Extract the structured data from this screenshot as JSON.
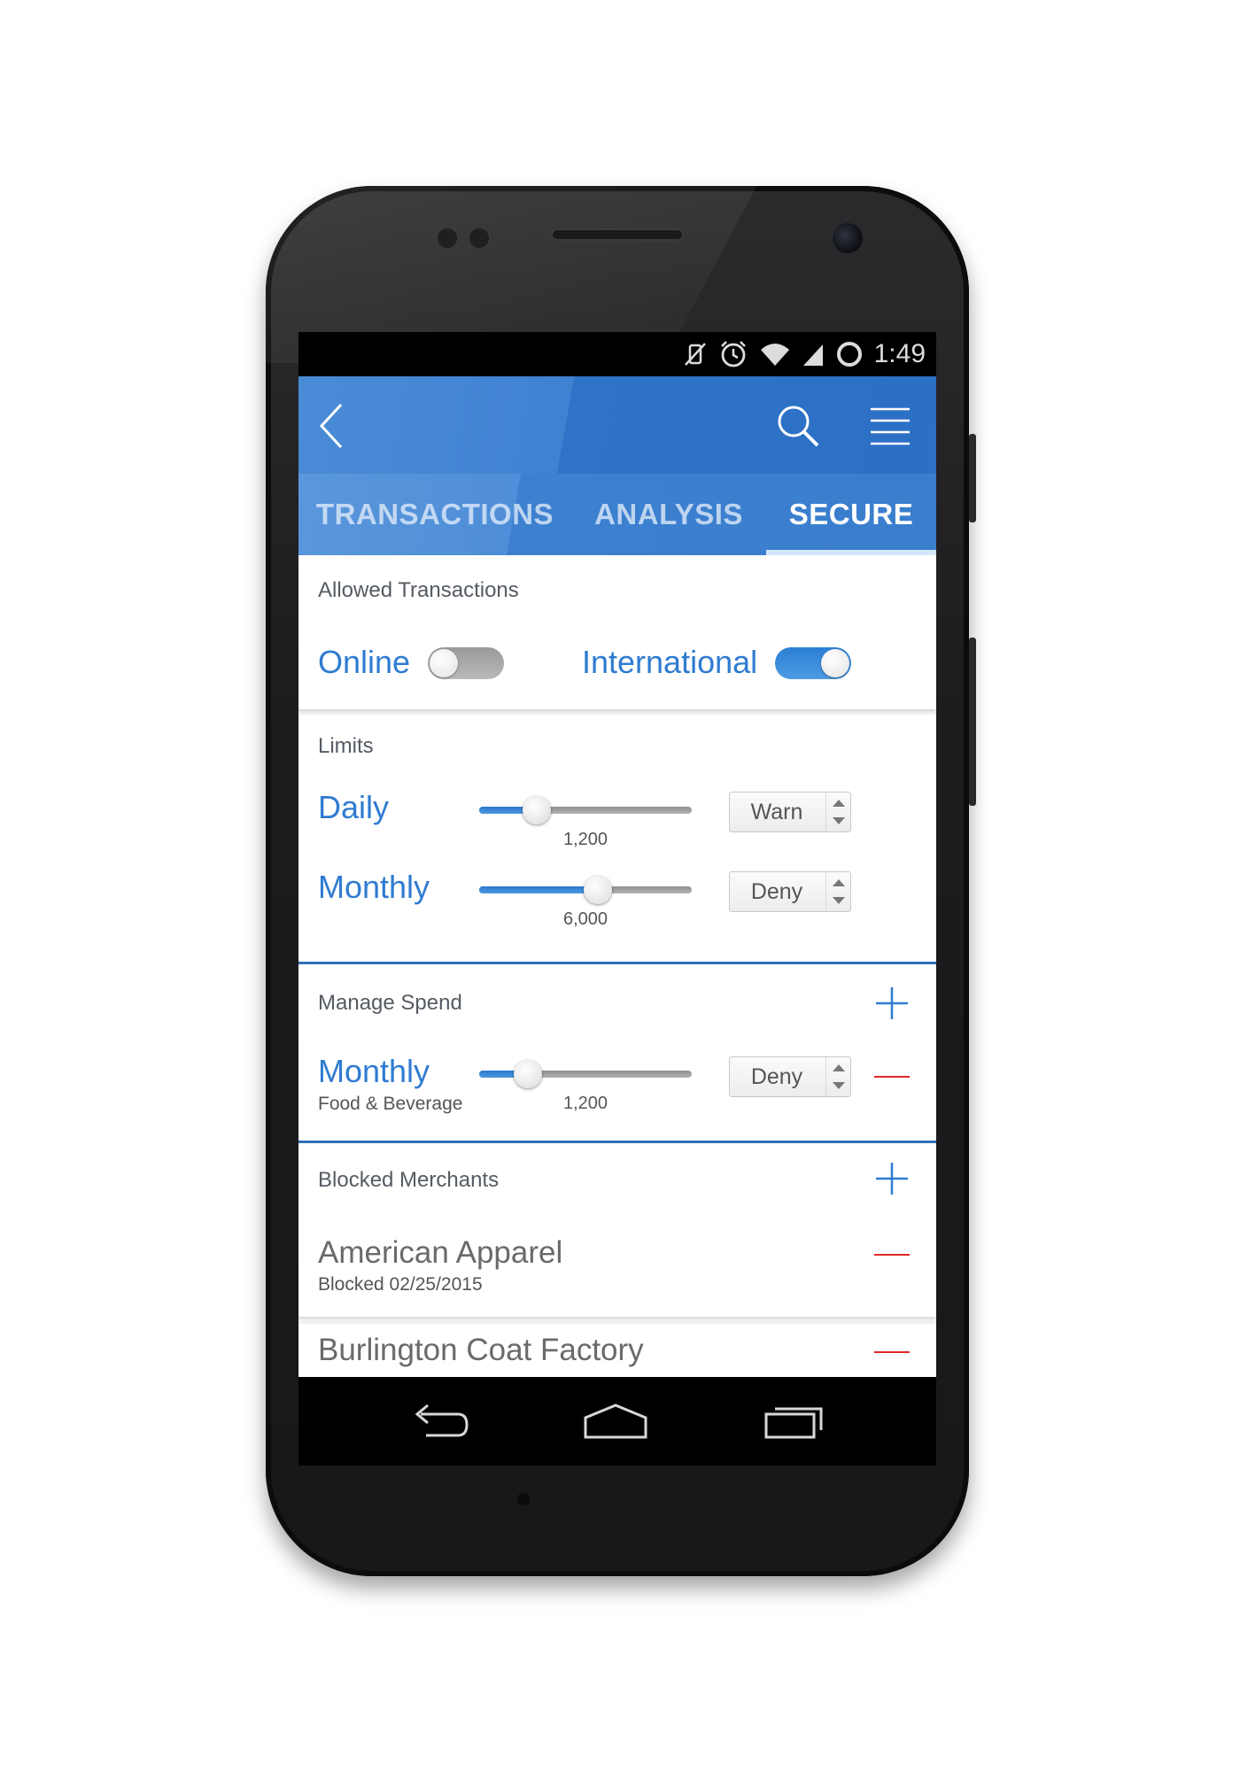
{
  "status_bar": {
    "time": "1:49",
    "icons": [
      "vibrate-off-icon",
      "alarm-icon",
      "wifi-icon",
      "signal-icon",
      "battery-icon"
    ]
  },
  "app_bar": {
    "icons": [
      "back-icon",
      "search-icon",
      "menu-icon"
    ]
  },
  "tabs": [
    {
      "label": "TRANSACTIONS",
      "active": false
    },
    {
      "label": "ANALYSIS",
      "active": false
    },
    {
      "label": "SECURE",
      "active": true
    }
  ],
  "allowed": {
    "title": "Allowed Transactions",
    "online": {
      "label": "Online",
      "enabled": false
    },
    "international": {
      "label": "International",
      "enabled": true
    }
  },
  "limits": {
    "title": "Limits",
    "daily": {
      "label": "Daily",
      "value": "1,200",
      "fill_fraction": 0.27,
      "action": "Warn"
    },
    "monthly": {
      "label": "Monthly",
      "value": "6,000",
      "fill_fraction": 0.56,
      "action": "Deny"
    }
  },
  "manage_spend": {
    "title": "Manage Spend",
    "items": [
      {
        "label": "Monthly",
        "category": "Food & Beverage",
        "value": "1,200",
        "fill_fraction": 0.23,
        "action": "Deny"
      }
    ]
  },
  "blocked_merchants": {
    "title": "Blocked Merchants",
    "items": [
      {
        "name": "American Apparel",
        "detail": "Blocked 02/25/2015"
      },
      {
        "name": "Burlington Coat Factory",
        "detail": ""
      }
    ]
  },
  "colors": {
    "accent_blue": "#2f7bd1",
    "remove_red": "#e0272a",
    "app_bar": "#2c70c6"
  },
  "nav_bar": {
    "icons": [
      "back-nav-icon",
      "home-nav-icon",
      "recents-nav-icon"
    ]
  }
}
